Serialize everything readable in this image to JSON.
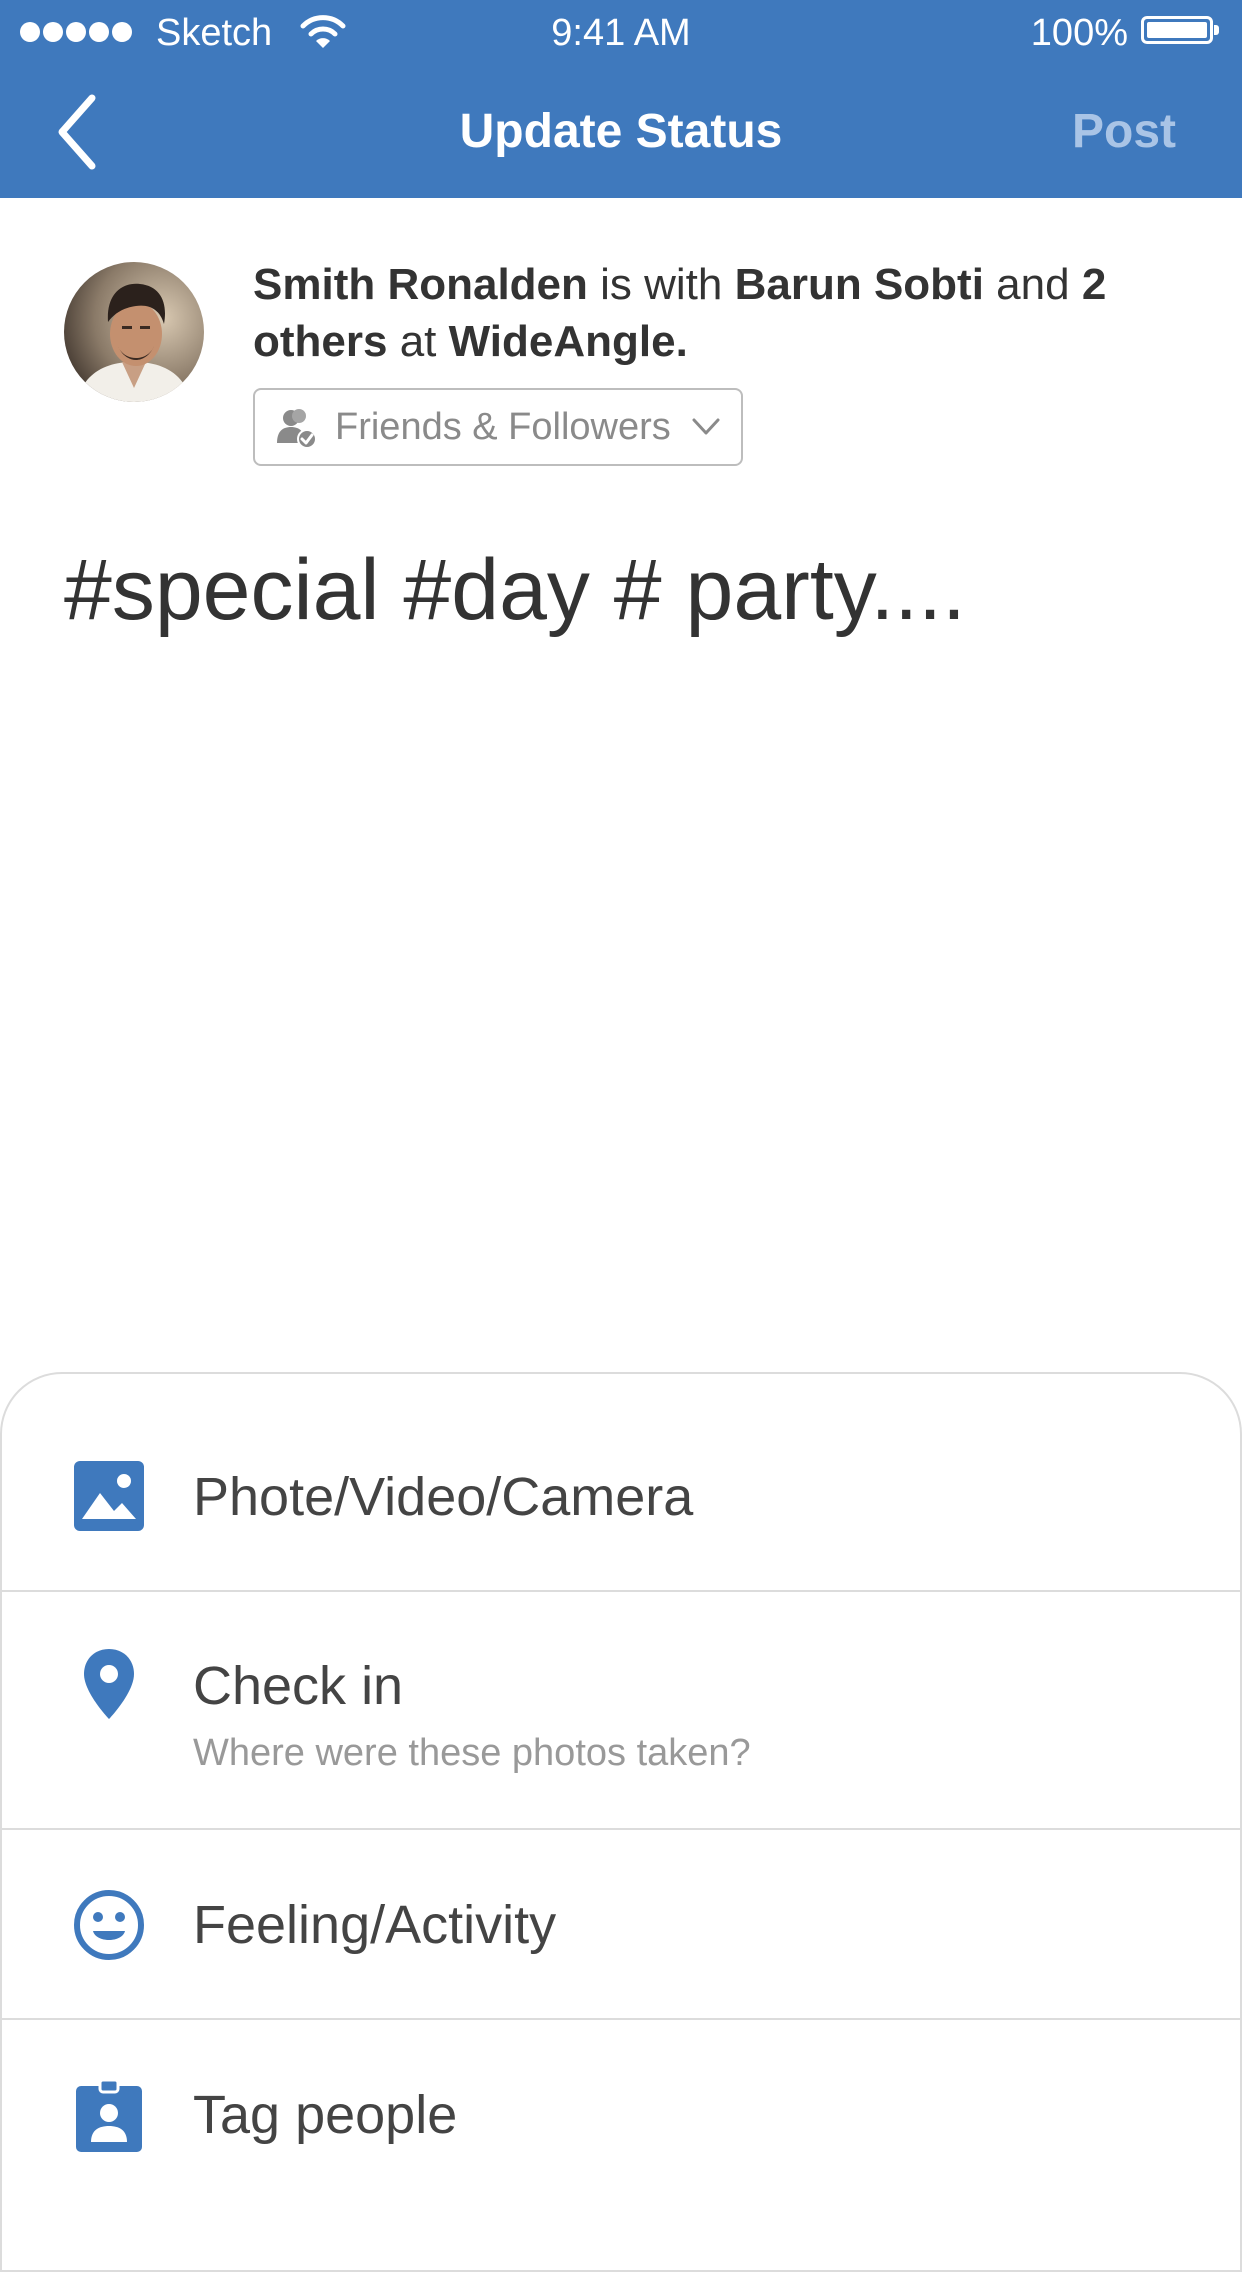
{
  "status_bar": {
    "signal_dots": 5,
    "carrier": "Sketch",
    "time": "9:41 AM",
    "battery": "100%"
  },
  "header": {
    "title": "Update Status",
    "post_label": "Post",
    "background_color": "#3f79bd"
  },
  "composer": {
    "author": "Smith Ronalden",
    "with_text": " is with ",
    "tagged_friend": "Barun Sobti",
    "and_text": " and ",
    "others": "2 others",
    "at_text": " at ",
    "place": "WideAngle.",
    "audience": "Friends & Followers",
    "post_text": "#special #day # party...."
  },
  "options": [
    {
      "label": "Phote/Video/Camera",
      "icon": "image-icon"
    },
    {
      "label": "Check in",
      "sublabel": "Where were these photos taken?",
      "icon": "location-pin-icon"
    },
    {
      "label": "Feeling/Activity",
      "icon": "smiley-icon"
    },
    {
      "label": "Tag people",
      "icon": "id-badge-icon"
    }
  ],
  "colors": {
    "accent": "#3f79bd",
    "post_disabled": "#a9c4e6",
    "divider": "#dcdcdc"
  }
}
